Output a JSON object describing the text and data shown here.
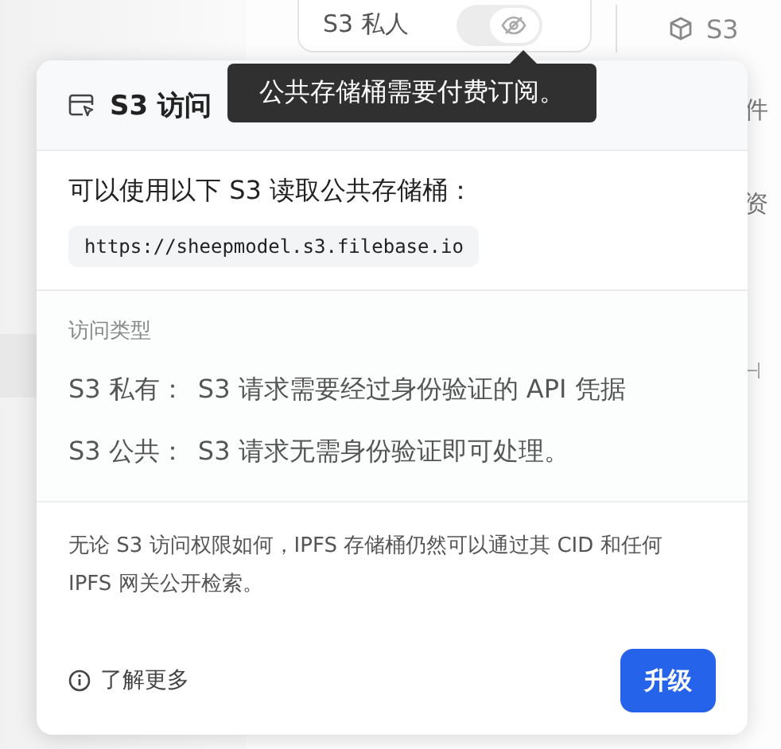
{
  "toolbar": {
    "access_toggle": {
      "label": "S3 私人",
      "on": false
    },
    "tab": {
      "label": "S3"
    }
  },
  "side_labels": [
    "件",
    "资"
  ],
  "tooltip": {
    "text": "公共存储桶需要付费订阅。"
  },
  "popover": {
    "title": "S3 访问",
    "intro": "可以使用以下 S3 读取公共存储桶：",
    "endpoint": "https://sheepmodel.s3.filebase.io",
    "access_types_heading": "访问类型",
    "access_types": [
      {
        "name": "S3 私有：",
        "description": "S3 请求需要经过身份验证的 API 凭据"
      },
      {
        "name": "S3 公共：",
        "description": "S3 请求无需身份验证即可处理。"
      }
    ],
    "note": "无论 S3 访问权限如何，IPFS 存储桶仍然可以通过其 CID 和任何 IPFS 网关公开检索。",
    "learn_more": "了解更多",
    "upgrade_button": "升级"
  }
}
